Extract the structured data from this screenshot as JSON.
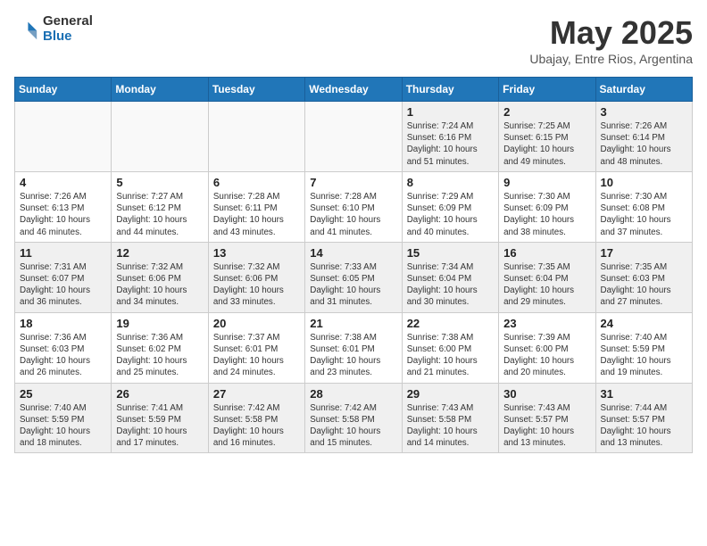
{
  "logo": {
    "general": "General",
    "blue": "Blue"
  },
  "title": {
    "month": "May 2025",
    "location": "Ubajay, Entre Rios, Argentina"
  },
  "weekdays": [
    "Sunday",
    "Monday",
    "Tuesday",
    "Wednesday",
    "Thursday",
    "Friday",
    "Saturday"
  ],
  "weeks": [
    [
      {
        "day": "",
        "info": ""
      },
      {
        "day": "",
        "info": ""
      },
      {
        "day": "",
        "info": ""
      },
      {
        "day": "",
        "info": ""
      },
      {
        "day": "1",
        "info": "Sunrise: 7:24 AM\nSunset: 6:16 PM\nDaylight: 10 hours\nand 51 minutes."
      },
      {
        "day": "2",
        "info": "Sunrise: 7:25 AM\nSunset: 6:15 PM\nDaylight: 10 hours\nand 49 minutes."
      },
      {
        "day": "3",
        "info": "Sunrise: 7:26 AM\nSunset: 6:14 PM\nDaylight: 10 hours\nand 48 minutes."
      }
    ],
    [
      {
        "day": "4",
        "info": "Sunrise: 7:26 AM\nSunset: 6:13 PM\nDaylight: 10 hours\nand 46 minutes."
      },
      {
        "day": "5",
        "info": "Sunrise: 7:27 AM\nSunset: 6:12 PM\nDaylight: 10 hours\nand 44 minutes."
      },
      {
        "day": "6",
        "info": "Sunrise: 7:28 AM\nSunset: 6:11 PM\nDaylight: 10 hours\nand 43 minutes."
      },
      {
        "day": "7",
        "info": "Sunrise: 7:28 AM\nSunset: 6:10 PM\nDaylight: 10 hours\nand 41 minutes."
      },
      {
        "day": "8",
        "info": "Sunrise: 7:29 AM\nSunset: 6:09 PM\nDaylight: 10 hours\nand 40 minutes."
      },
      {
        "day": "9",
        "info": "Sunrise: 7:30 AM\nSunset: 6:09 PM\nDaylight: 10 hours\nand 38 minutes."
      },
      {
        "day": "10",
        "info": "Sunrise: 7:30 AM\nSunset: 6:08 PM\nDaylight: 10 hours\nand 37 minutes."
      }
    ],
    [
      {
        "day": "11",
        "info": "Sunrise: 7:31 AM\nSunset: 6:07 PM\nDaylight: 10 hours\nand 36 minutes."
      },
      {
        "day": "12",
        "info": "Sunrise: 7:32 AM\nSunset: 6:06 PM\nDaylight: 10 hours\nand 34 minutes."
      },
      {
        "day": "13",
        "info": "Sunrise: 7:32 AM\nSunset: 6:06 PM\nDaylight: 10 hours\nand 33 minutes."
      },
      {
        "day": "14",
        "info": "Sunrise: 7:33 AM\nSunset: 6:05 PM\nDaylight: 10 hours\nand 31 minutes."
      },
      {
        "day": "15",
        "info": "Sunrise: 7:34 AM\nSunset: 6:04 PM\nDaylight: 10 hours\nand 30 minutes."
      },
      {
        "day": "16",
        "info": "Sunrise: 7:35 AM\nSunset: 6:04 PM\nDaylight: 10 hours\nand 29 minutes."
      },
      {
        "day": "17",
        "info": "Sunrise: 7:35 AM\nSunset: 6:03 PM\nDaylight: 10 hours\nand 27 minutes."
      }
    ],
    [
      {
        "day": "18",
        "info": "Sunrise: 7:36 AM\nSunset: 6:03 PM\nDaylight: 10 hours\nand 26 minutes."
      },
      {
        "day": "19",
        "info": "Sunrise: 7:36 AM\nSunset: 6:02 PM\nDaylight: 10 hours\nand 25 minutes."
      },
      {
        "day": "20",
        "info": "Sunrise: 7:37 AM\nSunset: 6:01 PM\nDaylight: 10 hours\nand 24 minutes."
      },
      {
        "day": "21",
        "info": "Sunrise: 7:38 AM\nSunset: 6:01 PM\nDaylight: 10 hours\nand 23 minutes."
      },
      {
        "day": "22",
        "info": "Sunrise: 7:38 AM\nSunset: 6:00 PM\nDaylight: 10 hours\nand 21 minutes."
      },
      {
        "day": "23",
        "info": "Sunrise: 7:39 AM\nSunset: 6:00 PM\nDaylight: 10 hours\nand 20 minutes."
      },
      {
        "day": "24",
        "info": "Sunrise: 7:40 AM\nSunset: 5:59 PM\nDaylight: 10 hours\nand 19 minutes."
      }
    ],
    [
      {
        "day": "25",
        "info": "Sunrise: 7:40 AM\nSunset: 5:59 PM\nDaylight: 10 hours\nand 18 minutes."
      },
      {
        "day": "26",
        "info": "Sunrise: 7:41 AM\nSunset: 5:59 PM\nDaylight: 10 hours\nand 17 minutes."
      },
      {
        "day": "27",
        "info": "Sunrise: 7:42 AM\nSunset: 5:58 PM\nDaylight: 10 hours\nand 16 minutes."
      },
      {
        "day": "28",
        "info": "Sunrise: 7:42 AM\nSunset: 5:58 PM\nDaylight: 10 hours\nand 15 minutes."
      },
      {
        "day": "29",
        "info": "Sunrise: 7:43 AM\nSunset: 5:58 PM\nDaylight: 10 hours\nand 14 minutes."
      },
      {
        "day": "30",
        "info": "Sunrise: 7:43 AM\nSunset: 5:57 PM\nDaylight: 10 hours\nand 13 minutes."
      },
      {
        "day": "31",
        "info": "Sunrise: 7:44 AM\nSunset: 5:57 PM\nDaylight: 10 hours\nand 13 minutes."
      }
    ]
  ]
}
